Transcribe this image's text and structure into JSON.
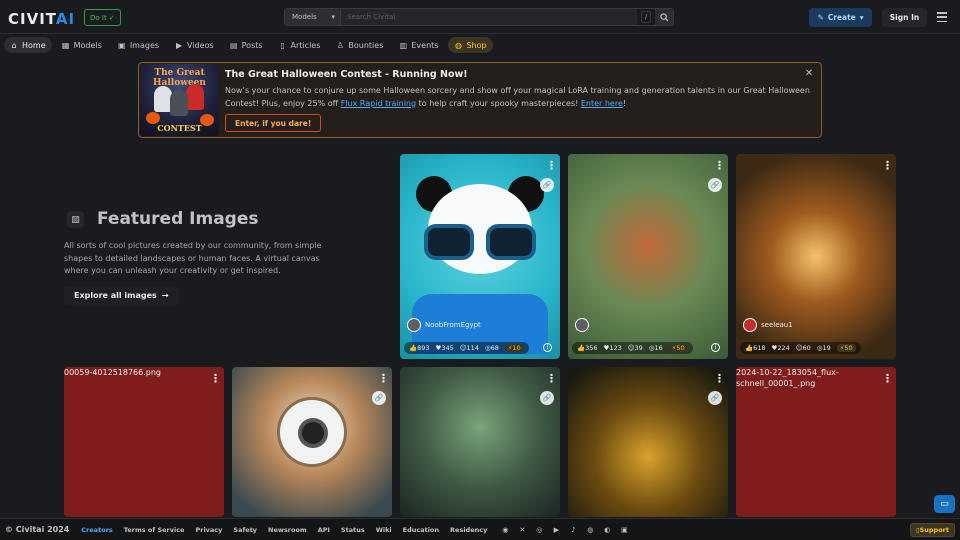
{
  "header": {
    "logo_main": "CIVIT",
    "logo_accent": "AI",
    "doit_label": "Do It",
    "search_category": "Models",
    "search_placeholder": "Search Civitai",
    "search_shortcut": "/",
    "create_label": "Create",
    "signin_label": "Sign In"
  },
  "nav": {
    "items": [
      {
        "label": "Home",
        "icon": "home-icon"
      },
      {
        "label": "Models",
        "icon": "models-icon"
      },
      {
        "label": "Images",
        "icon": "image-icon"
      },
      {
        "label": "Videos",
        "icon": "video-icon"
      },
      {
        "label": "Posts",
        "icon": "posts-icon"
      },
      {
        "label": "Articles",
        "icon": "article-icon"
      },
      {
        "label": "Bounties",
        "icon": "bounty-icon"
      },
      {
        "label": "Events",
        "icon": "calendar-icon"
      },
      {
        "label": "Shop",
        "icon": "shop-icon"
      }
    ],
    "active": "Home"
  },
  "banner": {
    "image_title": "The Great Halloween",
    "image_subtitle": "CONTEST",
    "title": "The Great Halloween Contest - Running Now!",
    "body_part1": "Now’s your chance to conjure up some Halloween sorcery and show off your magical LoRA training and generation talents in our Great Halloween Contest! Plus, enjoy 25% off ",
    "body_link1": "Flux Rapid training",
    "body_part2": " to help craft your spooky masterpieces! ",
    "body_link2": "Enter here",
    "body_part3": "!",
    "cta_label": "Enter, if you dare!"
  },
  "featured": {
    "title": "Featured Images",
    "description": "All sorts of cool pictures created by our community, from simple shapes to detailed landscapes or human faces. A virtual canvas where you can unleash your creativity or get inspired.",
    "explore_label": "Explore all images"
  },
  "cards": [
    {
      "user": "NoobFromEgypt",
      "stats": {
        "likes": "893",
        "hearts": "345",
        "laughs": "114",
        "cries": "68",
        "buzz": "10"
      }
    },
    {
      "user": "",
      "stats": {
        "likes": "356",
        "hearts": "123",
        "laughs": "39",
        "cries": "16",
        "buzz": "50"
      }
    },
    {
      "user": "seeleau1",
      "stats": {
        "likes": "618",
        "hearts": "224",
        "laughs": "60",
        "cries": "19",
        "buzz": "50"
      }
    },
    {
      "alt": "00059-4012518766.png"
    },
    {},
    {},
    {},
    {
      "alt": "2024-10-22_183054_flux-schnell_00001_.png"
    }
  ],
  "footer": {
    "copyright": "© Civitai 2024",
    "links": [
      "Creators",
      "Terms of Service",
      "Privacy",
      "Safety",
      "Newsroom",
      "API",
      "Status",
      "Wiki",
      "Education",
      "Residency"
    ],
    "support_label": "Support"
  },
  "colors": {
    "accent": "#228be6",
    "background": "#1a1b1e",
    "banner_border": "#8c5a22",
    "shop": "#fcc419"
  }
}
